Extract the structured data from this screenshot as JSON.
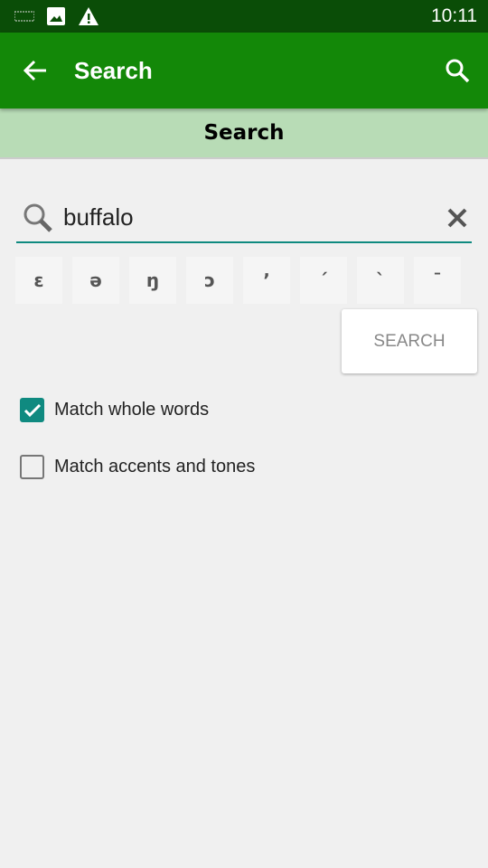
{
  "status_bar": {
    "time": "10:11",
    "icons": [
      "keyboard-icon",
      "image-icon",
      "warning-icon"
    ]
  },
  "appbar": {
    "title": "Search",
    "back_icon": "arrow-back-icon",
    "search_icon": "search-icon"
  },
  "subheader": {
    "title": "Search"
  },
  "search": {
    "value": "buffalo",
    "placeholder": ""
  },
  "special_chars": [
    "ɛ",
    "ə",
    "ŋ",
    "ɔ",
    "ʼ",
    "ˊ",
    "ˋ",
    "ˉ"
  ],
  "search_button": "SEARCH",
  "options": [
    {
      "label": "Match whole words",
      "checked": true
    },
    {
      "label": "Match accents and tones",
      "checked": false
    }
  ],
  "colors": {
    "appbar": "#138808",
    "status": "#0a4d07",
    "subheader": "#b8dcb6",
    "accent": "#0f8a80"
  }
}
